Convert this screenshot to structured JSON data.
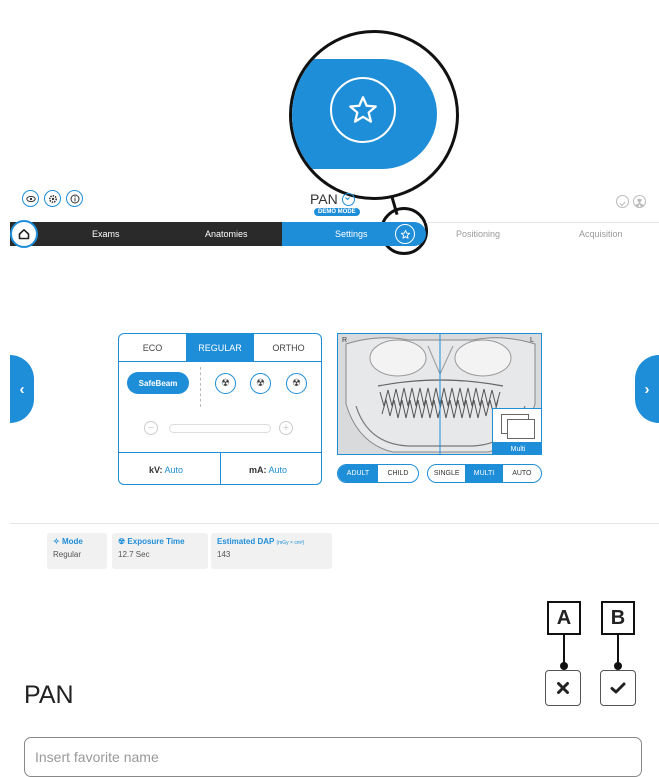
{
  "header": {
    "icons": [
      "eye-icon",
      "gear-icon",
      "info-icon"
    ],
    "title": "PAN",
    "badge": "DEMO MODE",
    "right_icons": [
      "check-circle-icon",
      "radiation-icon"
    ]
  },
  "nav": {
    "items": [
      {
        "label": "Exams"
      },
      {
        "label": "Anatomies"
      },
      {
        "label": "Settings"
      },
      {
        "label": "Positioning"
      },
      {
        "label": "Acquisition"
      }
    ],
    "favorite_icon": "star-icon"
  },
  "settings_panel": {
    "modes": [
      "ECO",
      "REGULAR",
      "ORTHO"
    ],
    "active_mode": "REGULAR",
    "safebeam_label": "SafeBeam",
    "kv_label": "kV:",
    "kv_value": "Auto",
    "ma_label": "mA:",
    "ma_value": "Auto"
  },
  "xray": {
    "left_marker": "R",
    "right_marker": "L",
    "multi_label": "Multi"
  },
  "patient_toggle": {
    "options": [
      "ADULT",
      "CHILD"
    ],
    "active": "ADULT"
  },
  "capture_toggle": {
    "options": [
      "SINGLE",
      "MULTI",
      "AUTO"
    ],
    "active": "MULTI"
  },
  "info": {
    "mode": {
      "label": "Mode",
      "value": "Regular"
    },
    "exposure": {
      "label": "Exposure Time",
      "value": "12.7 Sec"
    },
    "dap": {
      "label": "Estimated DAP",
      "unit": "(mGy × cm²)",
      "value": "143"
    }
  },
  "callouts": {
    "a": "A",
    "b": "B"
  },
  "favorite": {
    "title": "PAN",
    "input_placeholder": "Insert favorite name",
    "input_value": ""
  },
  "colors": {
    "accent": "#1f8ed8",
    "dark": "#2a2a2a"
  }
}
